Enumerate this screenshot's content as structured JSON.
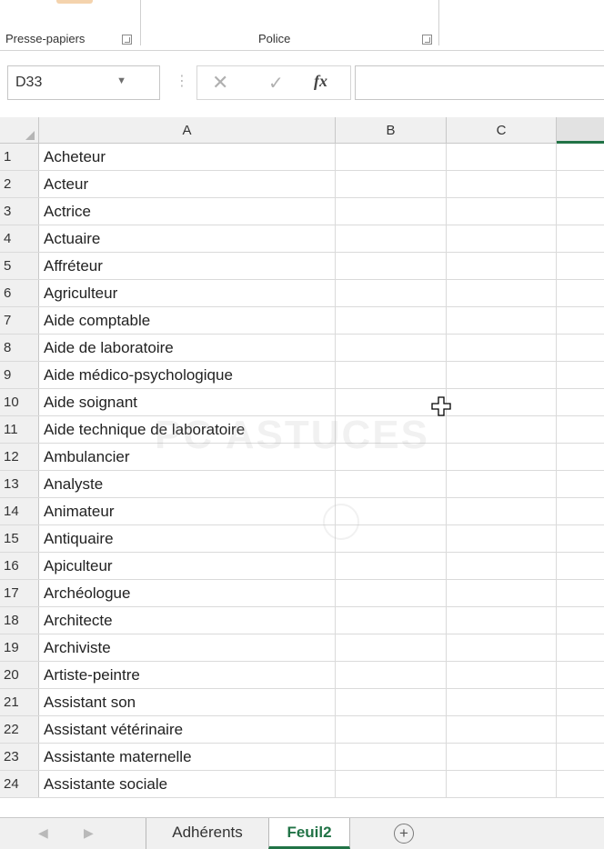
{
  "ribbon": {
    "groups": [
      {
        "label": "Presse-papiers"
      },
      {
        "label": "Police"
      }
    ]
  },
  "formula_bar": {
    "name_box": "D33",
    "fx_label": "fx",
    "formula_value": ""
  },
  "columns": [
    "A",
    "B",
    "C",
    ""
  ],
  "rows": [
    {
      "num": "1",
      "a": "Acheteur"
    },
    {
      "num": "2",
      "a": "Acteur"
    },
    {
      "num": "3",
      "a": "Actrice"
    },
    {
      "num": "4",
      "a": "Actuaire"
    },
    {
      "num": "5",
      "a": "Affréteur"
    },
    {
      "num": "6",
      "a": "Agriculteur"
    },
    {
      "num": "7",
      "a": "Aide comptable"
    },
    {
      "num": "8",
      "a": "Aide de laboratoire"
    },
    {
      "num": "9",
      "a": "Aide médico-psychologique"
    },
    {
      "num": "10",
      "a": "Aide soignant"
    },
    {
      "num": "11",
      "a": "Aide technique de laboratoire"
    },
    {
      "num": "12",
      "a": "Ambulancier"
    },
    {
      "num": "13",
      "a": "Analyste"
    },
    {
      "num": "14",
      "a": "Animateur"
    },
    {
      "num": "15",
      "a": "Antiquaire"
    },
    {
      "num": "16",
      "a": "Apiculteur"
    },
    {
      "num": "17",
      "a": "Archéologue"
    },
    {
      "num": "18",
      "a": "Architecte"
    },
    {
      "num": "19",
      "a": "Archiviste"
    },
    {
      "num": "20",
      "a": "Artiste-peintre"
    },
    {
      "num": "21",
      "a": "Assistant son"
    },
    {
      "num": "22",
      "a": "Assistant vétérinaire"
    },
    {
      "num": "23",
      "a": "Assistante maternelle"
    },
    {
      "num": "24",
      "a": "Assistante sociale"
    }
  ],
  "sheet_tabs": [
    {
      "label": "Adhérents",
      "active": false
    },
    {
      "label": "Feuil2",
      "active": true
    }
  ],
  "add_sheet_label": "+",
  "watermark": "PC ASTUCES",
  "colors": {
    "excel_green": "#217346"
  }
}
